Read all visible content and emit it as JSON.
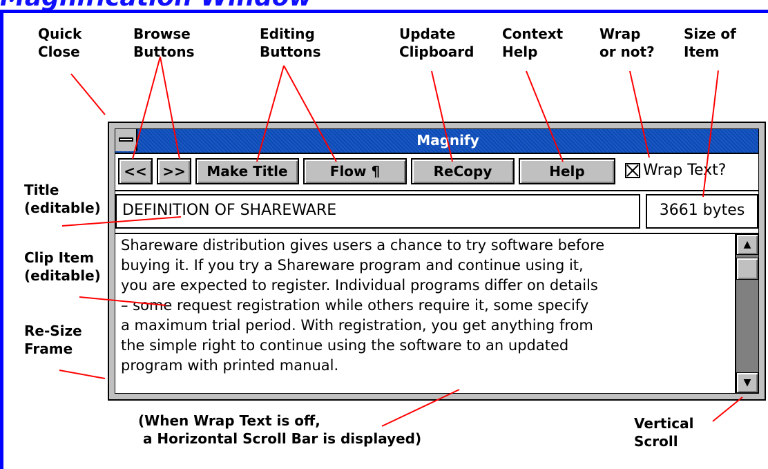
{
  "page": {
    "heading": "Magnification Window"
  },
  "annotations": {
    "quick_close": "Quick\nClose",
    "browse_buttons": "Browse\nButtons",
    "editing_buttons": "Editing\nButtons",
    "update_clipboard": "Update\nClipboard",
    "context_help": "Context\nHelp",
    "wrap_or_not": "Wrap\nor not?",
    "size_of_item": "Size of\nItem",
    "title_editable": "Title\n(editable)",
    "clip_item_editable": "Clip Item\n(editable)",
    "resize_frame": "Re-Size\nFrame",
    "vertical_scroll": "Vertical\nScroll",
    "horizontal_note": "(When Wrap Text is off,\n a Horizontal Scroll Bar is displayed)"
  },
  "window": {
    "title": "Magnify",
    "toolbar": {
      "prev_label": "<<",
      "next_label": ">>",
      "make_title_label": "Make Title",
      "flow_label": "Flow ¶",
      "recopy_label": "ReCopy",
      "help_label": "Help",
      "wrap_label": "Wrap Text?",
      "wrap_checked": true
    },
    "title_field_value": "DEFINITION OF SHAREWARE",
    "size_value": "3661 bytes",
    "clip_text": "Shareware distribution gives users a chance to try software before\nbuying it. If you try a Shareware program and continue using it,\nyou are expected to register. Individual programs differ on details\n– some request registration while others require it, some specify\na maximum trial period. With registration, you get anything from\nthe simple right to continue using the software to an updated\nprogram with printed manual."
  },
  "icons": {
    "system_menu": "minus-bar-icon",
    "checkbox_mark": "x-check-icon",
    "scroll_up": "arrow-up-icon",
    "scroll_down": "arrow-down-icon"
  },
  "colors": {
    "heading_blue": "#1010ff",
    "titlebar_blue": "#0a4ab8",
    "leader_red": "#ff0000",
    "button_gray": "#c0c0c0",
    "scroll_gray": "#808080"
  }
}
